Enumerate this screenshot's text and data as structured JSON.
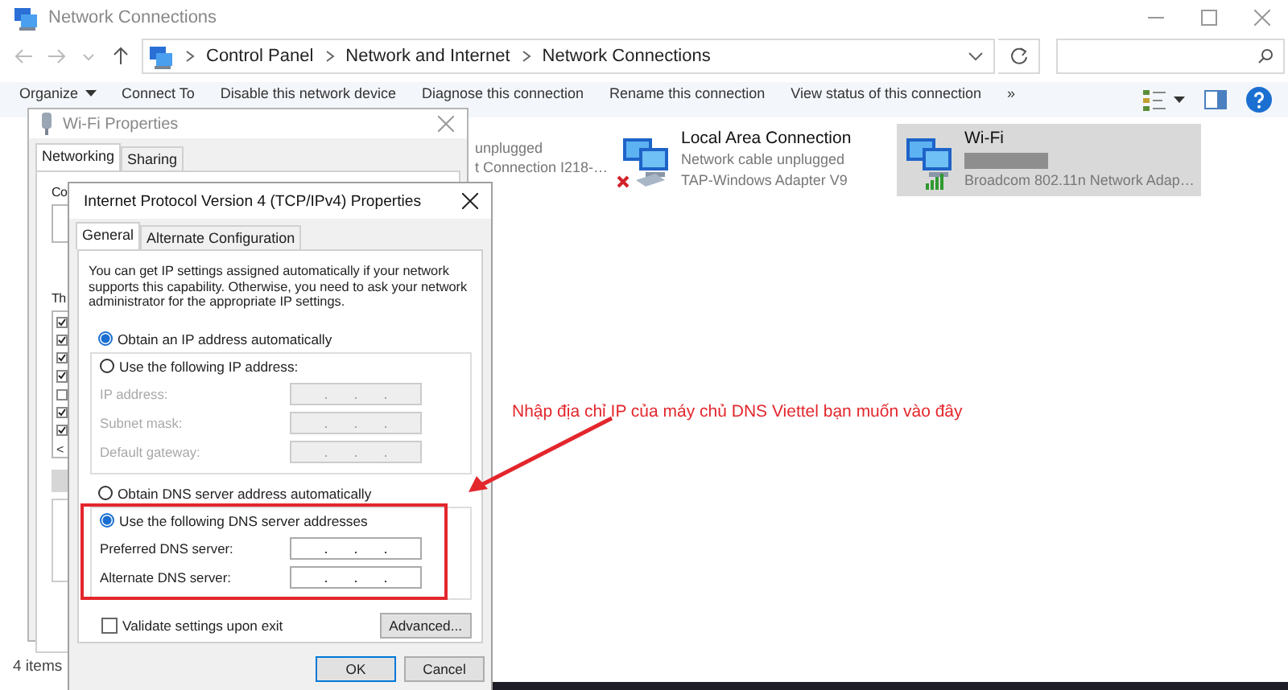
{
  "window": {
    "title": "Network Connections"
  },
  "address_bar": {
    "path": [
      "Control Panel",
      "Network and Internet",
      "Network Connections"
    ]
  },
  "toolbar": {
    "commands": [
      {
        "label": "Organize",
        "kind": "menu"
      },
      {
        "label": "Connect To",
        "kind": "command"
      },
      {
        "label": "Disable this network device",
        "kind": "command"
      },
      {
        "label": "Diagnose this connection",
        "kind": "command"
      },
      {
        "label": "Rename this connection",
        "kind": "command"
      },
      {
        "label": "View status of this connection",
        "kind": "command"
      },
      {
        "label": "»",
        "kind": "overflow"
      }
    ]
  },
  "connections": [
    {
      "kind": "partial",
      "status": "unplugged",
      "device": "t Connection I218-…",
      "selected": false
    },
    {
      "kind": "ethernet",
      "name": "Local Area Connection",
      "status": "Network cable unplugged",
      "device": "TAP-Windows Adapter V9",
      "disconnected": true,
      "selected": false
    },
    {
      "kind": "wifi",
      "name": "Wi-Fi",
      "status_redacted": true,
      "device": "Broadcom 802.11n Network Adap…",
      "disconnected": false,
      "selected": true
    }
  ],
  "status_bar": {
    "items": "4 items"
  },
  "wifi_properties": {
    "title": "Wi-Fi Properties",
    "tabs": [
      {
        "label": "Networking",
        "selected": true
      },
      {
        "label": "Sharing",
        "selected": false
      }
    ],
    "labels": [
      "Co",
      "Th"
    ],
    "components": [
      {
        "checked": true
      },
      {
        "checked": true
      },
      {
        "checked": true
      },
      {
        "checked": true
      },
      {
        "checked": false
      },
      {
        "checked": true
      },
      {
        "checked": true
      }
    ],
    "scroll_glyph": "<"
  },
  "ipv4_properties": {
    "title": "Internet Protocol Version 4 (TCP/IPv4) Properties",
    "tabs": [
      {
        "label": "General",
        "selected": true
      },
      {
        "label": "Alternate Configuration",
        "selected": false
      }
    ],
    "intro": "You can get IP settings assigned automatically if your network supports this capability. Otherwise, you need to ask your network administrator for the appropriate IP settings.",
    "ip_mode": [
      {
        "label": "Obtain an IP address automatically",
        "selected": true
      },
      {
        "label": "Use the following IP address:",
        "selected": false
      }
    ],
    "ip_fields": [
      {
        "label": "IP address:",
        "disabled": true
      },
      {
        "label": "Subnet mask:",
        "disabled": true
      },
      {
        "label": "Default gateway:",
        "disabled": true
      }
    ],
    "dns_mode": [
      {
        "label": "Obtain DNS server address automatically",
        "selected": false
      },
      {
        "label": "Use the following DNS server addresses",
        "selected": true
      }
    ],
    "dns_fields": [
      {
        "label": "Preferred DNS server:",
        "disabled": false
      },
      {
        "label": "Alternate DNS server:",
        "disabled": false
      }
    ],
    "ip_separator": ".",
    "validate": {
      "label": "Validate settings upon exit",
      "checked": false
    },
    "advanced_button": "Advanced...",
    "buttons": [
      {
        "label": "OK",
        "focused": true
      },
      {
        "label": "Cancel",
        "focused": false
      }
    ]
  },
  "annotation": {
    "text": "Nhập địa chỉ IP của máy chủ DNS Viettel bạn muốn vào đây",
    "color": "#e3262c"
  }
}
